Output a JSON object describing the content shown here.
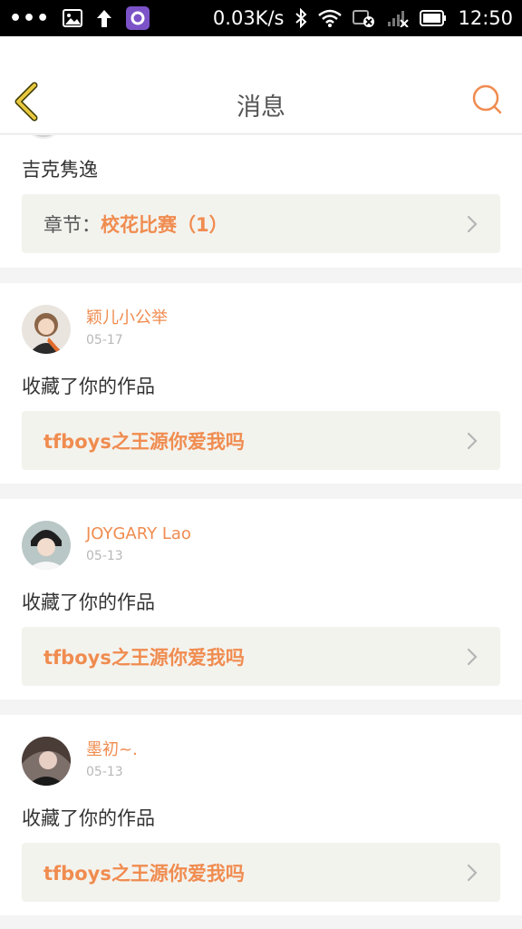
{
  "status_bar": {
    "dots": "•••",
    "speed": "0.03K/s",
    "time": "12:50",
    "icons": [
      "image-icon",
      "upload-arrow-icon",
      "app-icon",
      "bluetooth-icon",
      "wifi-icon",
      "alarm-off-icon",
      "signal-icon",
      "battery-icon"
    ]
  },
  "header": {
    "title": "消息",
    "back_icon": "chevron-left-icon",
    "search_icon": "search-icon",
    "accent_color": "#f08c50"
  },
  "messages": [
    {
      "message": "吉克隽逸",
      "chapter_label": "章节：",
      "link": "校花比赛（1）"
    },
    {
      "username": "颖儿小公举",
      "date": "05-17",
      "message": "收藏了你的作品",
      "link": "tfboys之王源你爱我吗"
    },
    {
      "username": "JOYGARY Lao",
      "date": "05-13",
      "message": "收藏了你的作品",
      "link": "tfboys之王源你爱我吗"
    },
    {
      "username": "墨初~.",
      "date": "05-13",
      "message": "收藏了你的作品",
      "link": "tfboys之王源你爱我吗"
    }
  ]
}
